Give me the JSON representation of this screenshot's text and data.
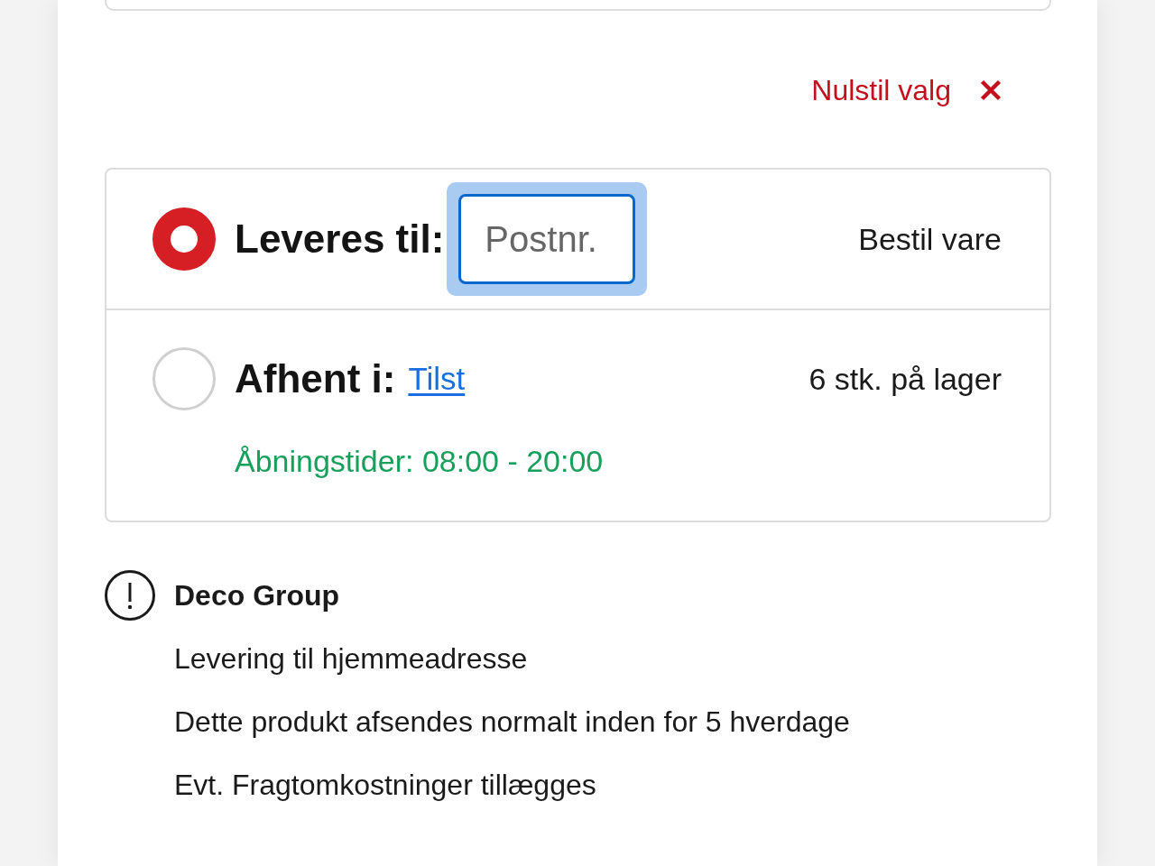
{
  "reset": {
    "label": "Nulstil valg"
  },
  "options": [
    {
      "kind": "delivery",
      "selected": true,
      "label": "Leveres til:",
      "postcode_field": {
        "placeholder": "Postnr.",
        "focused": true
      },
      "status": "Bestil vare"
    },
    {
      "kind": "pickup",
      "selected": false,
      "label": "Afhent i:",
      "store_link": "Tilst",
      "status": "6 stk. på lager",
      "opening_hours": "Åbningstider: 08:00 - 20:00"
    }
  ],
  "notice": {
    "title": "Deco Group",
    "lines": [
      "Levering til hjemmeadresse",
      "Dette produkt afsendes normalt inden for 5 hverdage",
      "Evt. Fragtomkostninger tillægges"
    ]
  }
}
